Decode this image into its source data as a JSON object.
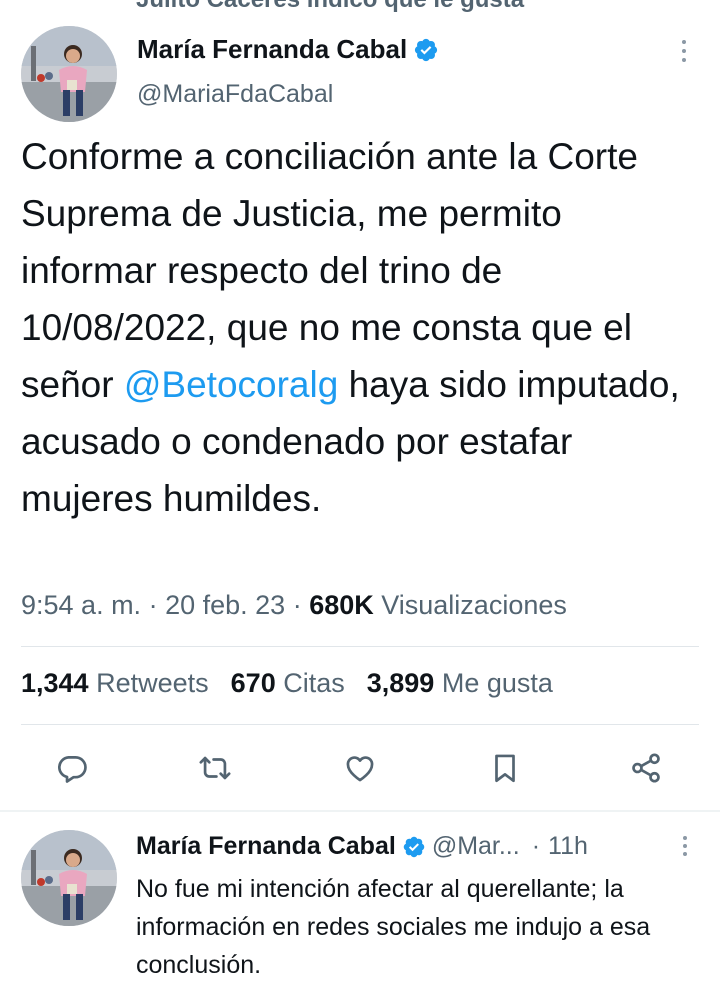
{
  "top_partial_text": "Julito Cáceres indicó que le gusta",
  "main_tweet": {
    "author_name": "María Fernanda Cabal",
    "handle": "@MariaFdaCabal",
    "text_before": "Conforme a conciliación ante la Corte Suprema de Justicia, me permito informar respecto del trino de 10/08/2022, que no me consta que el señor ",
    "mention": "@Betocoralg",
    "text_after": " haya sido imputado, acusado o condenado por estafar mujeres humildes.",
    "time": "9:54 a. m.",
    "sep": " · ",
    "date": "20 feb. 23",
    "views_count": "680K",
    "views_label": "Visualizaciones",
    "stats": {
      "retweets_count": "1,344",
      "retweets_label": "Retweets",
      "quotes_count": "670",
      "quotes_label": "Citas",
      "likes_count": "3,899",
      "likes_label": "Me gusta"
    }
  },
  "reply_tweet": {
    "author_name": "María Fernanda Cabal",
    "handle": "@Mar...",
    "dot": "·",
    "time": "11h",
    "text": "No fue mi intención afectar al querellante; la información en redes sociales me indujo a esa conclusión."
  },
  "colors": {
    "accent": "#1d9bf0",
    "text": "#0f1419",
    "secondary": "#536471",
    "icon": "#536471"
  },
  "icons": [
    "verified-badge-icon",
    "more-options-icon",
    "reply-icon",
    "retweet-icon",
    "like-icon",
    "bookmark-icon",
    "share-icon"
  ]
}
